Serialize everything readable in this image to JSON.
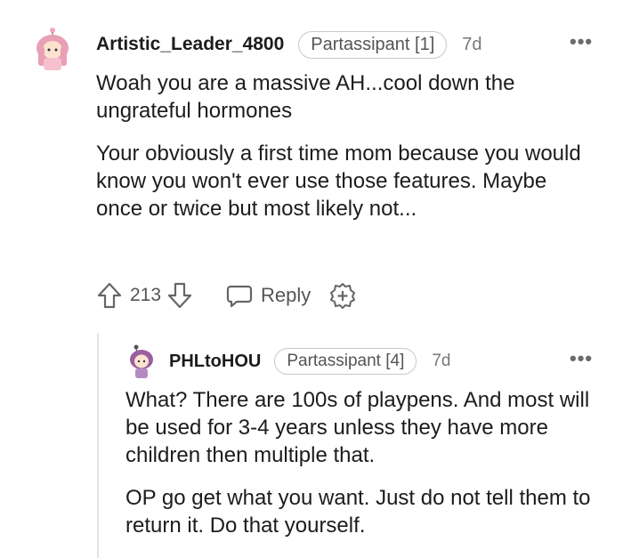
{
  "comments": [
    {
      "username": "Artistic_Leader_4800",
      "flair": "Partassipant [1]",
      "age": "7d",
      "body": [
        "Woah you are a massive AH...cool down the ungrateful hormones",
        "Your obviously a first time mom because you would know you won't ever use those features. Maybe once or twice but most likely not..."
      ],
      "score": "213",
      "reply_label": "Reply",
      "more_icon": "more-options-icon"
    },
    {
      "username": "PHLtoHOU",
      "flair": "Partassipant [4]",
      "age": "7d",
      "body": [
        "What? There are 100s of playpens. And most will be used for 3-4 years unless they have more children then multiple that.",
        "OP go get what you want. Just do not tell them to return it. Do that yourself."
      ],
      "more_icon": "more-options-icon"
    }
  ],
  "colors": {
    "text": "#1c1c1c",
    "muted": "#777777",
    "flair_border": "#c9c9c9",
    "avatar1_hair": "#e8a0b4",
    "avatar2_hair": "#9a5fa0"
  }
}
